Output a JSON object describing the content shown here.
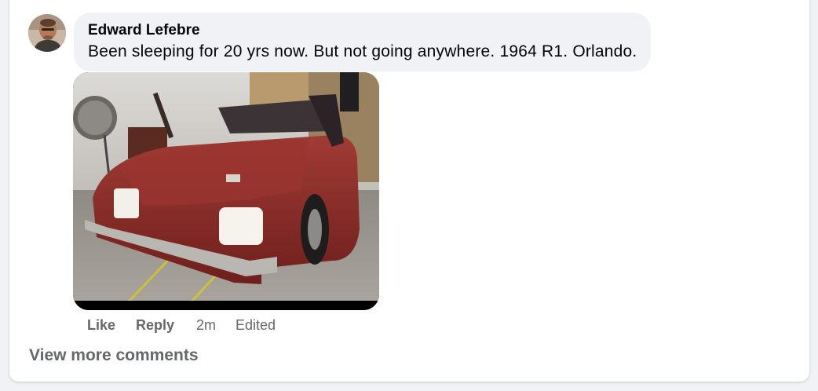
{
  "comment": {
    "author": "Edward Lefebre",
    "text": "Been sleeping for 20 yrs now. But not going anywhere. 1964 R1. Orlando."
  },
  "actions": {
    "like": "Like",
    "reply": "Reply",
    "time": "2m",
    "edited": "Edited"
  },
  "footer": {
    "view_more": "View more comments"
  },
  "colors": {
    "bubble": "#f0f2f5",
    "secondary_text": "#65676b",
    "primary_text": "#050505",
    "car_body": "#8b2a28"
  },
  "icons": {
    "avatar": "profile-photo",
    "photo": "red-car-in-garage-photo"
  }
}
